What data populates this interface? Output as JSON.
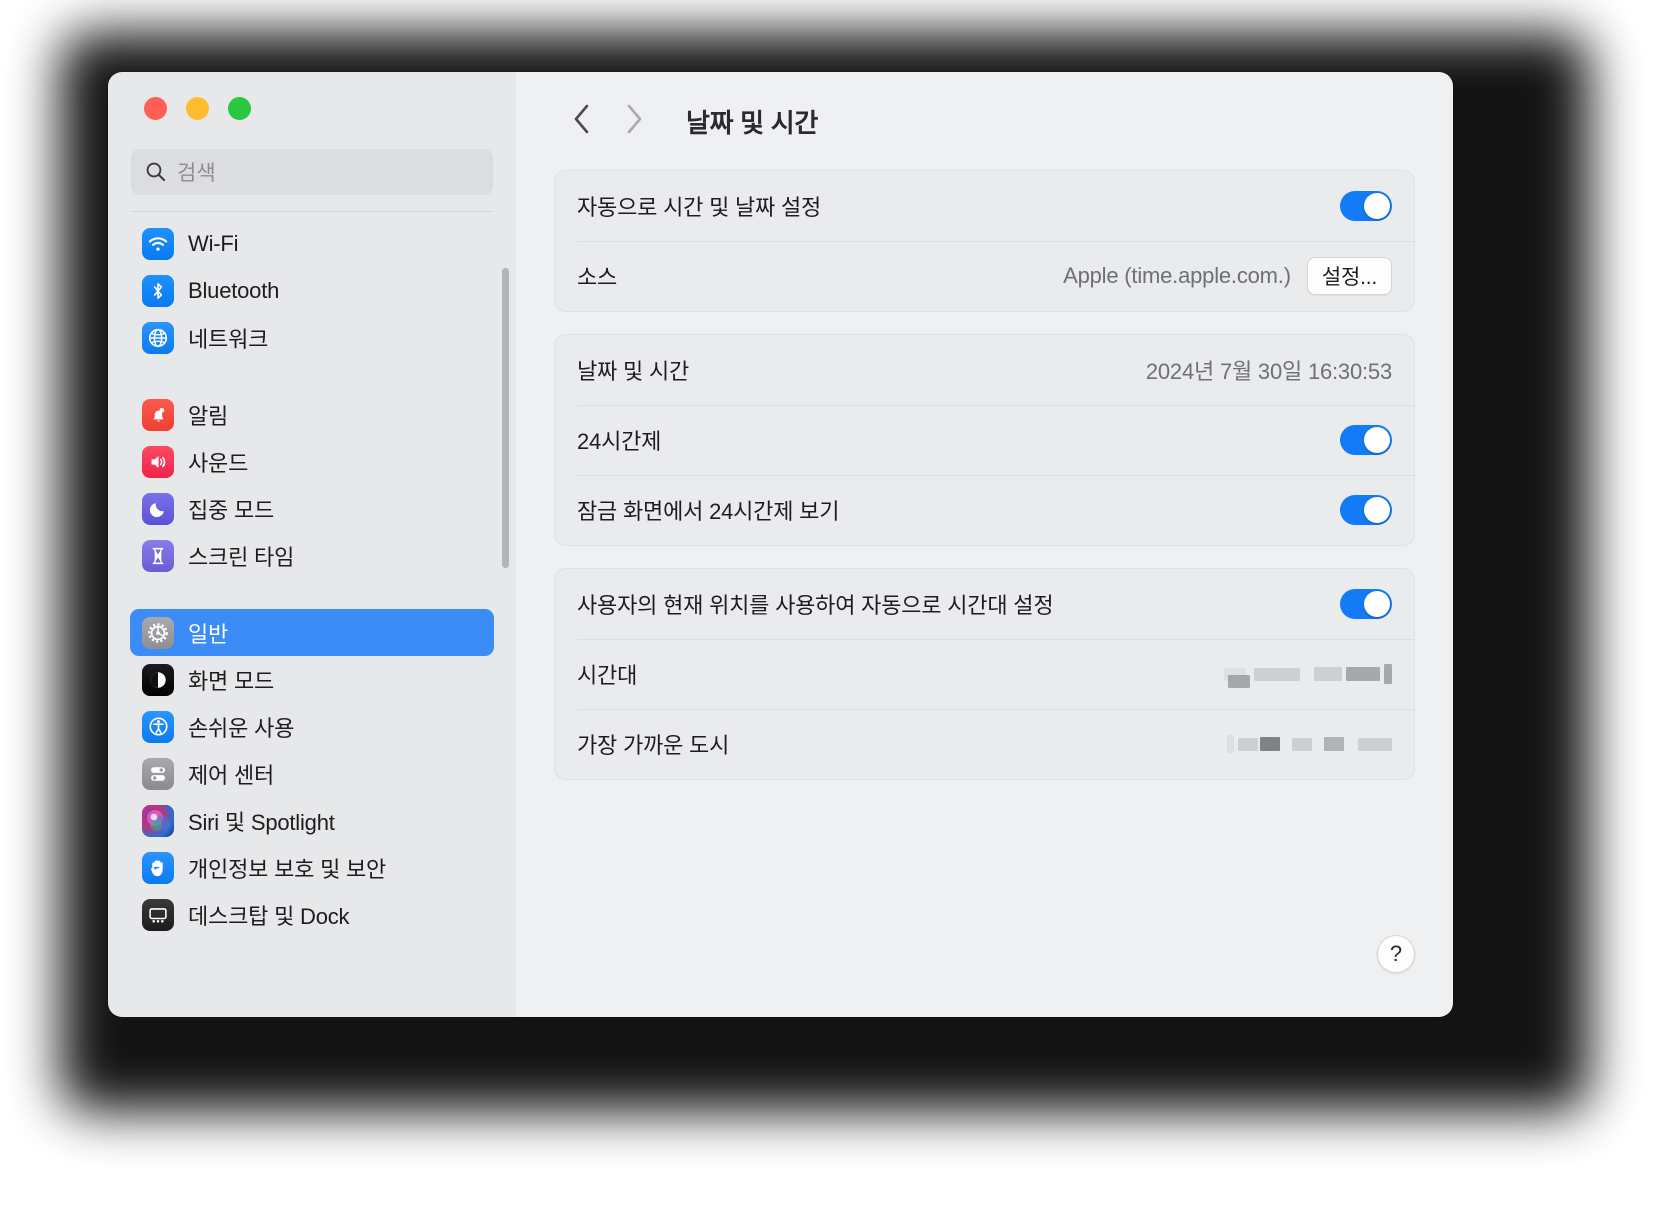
{
  "window": {
    "traffic_lights": [
      {
        "name": "close",
        "color": "#ff5f57"
      },
      {
        "name": "minimize",
        "color": "#febc2e"
      },
      {
        "name": "zoom",
        "color": "#28c840"
      }
    ]
  },
  "search": {
    "placeholder": "검색",
    "icon": "search-icon"
  },
  "sidebar": {
    "groups": [
      {
        "items": [
          {
            "label": "Wi-Fi",
            "icon": "wifi-icon",
            "icon_class": "ic-wifi",
            "selected": false
          },
          {
            "label": "Bluetooth",
            "icon": "bluetooth-icon",
            "icon_class": "ic-bluetooth",
            "selected": false
          },
          {
            "label": "네트워크",
            "icon": "globe-icon",
            "icon_class": "ic-network",
            "selected": false
          }
        ]
      },
      {
        "items": [
          {
            "label": "알림",
            "icon": "bell-icon",
            "icon_class": "ic-notify",
            "selected": false
          },
          {
            "label": "사운드",
            "icon": "speaker-icon",
            "icon_class": "ic-sound",
            "selected": false
          },
          {
            "label": "집중 모드",
            "icon": "moon-icon",
            "icon_class": "ic-focus",
            "selected": false
          },
          {
            "label": "스크린 타임",
            "icon": "hourglass-icon",
            "icon_class": "ic-screen",
            "selected": false
          }
        ]
      },
      {
        "items": [
          {
            "label": "일반",
            "icon": "gear-icon",
            "icon_class": "ic-general",
            "selected": true
          },
          {
            "label": "화면 모드",
            "icon": "appearance-icon",
            "icon_class": "ic-display",
            "selected": false
          },
          {
            "label": "손쉬운 사용",
            "icon": "accessibility-icon",
            "icon_class": "ic-access",
            "selected": false
          },
          {
            "label": "제어 센터",
            "icon": "control-center-icon",
            "icon_class": "ic-control",
            "selected": false
          },
          {
            "label": "Siri 및 Spotlight",
            "icon": "siri-icon",
            "icon_class": "ic-siri",
            "selected": false
          },
          {
            "label": "개인정보 보호 및 보안",
            "icon": "hand-icon",
            "icon_class": "ic-privacy",
            "selected": false
          },
          {
            "label": "데스크탑 및 Dock",
            "icon": "desktop-dock-icon",
            "icon_class": "ic-desktop",
            "selected": false
          }
        ]
      }
    ]
  },
  "toolbar": {
    "back_icon": "chevron-left-icon",
    "forward_icon": "chevron-right-icon",
    "title": "날짜 및 시간"
  },
  "settings": {
    "group1": {
      "auto_datetime_label": "자동으로 시간 및 날짜 설정",
      "auto_datetime_on": true,
      "source_label": "소스",
      "source_value": "Apple (time.apple.com.)",
      "source_button": "설정..."
    },
    "group2": {
      "datetime_label": "날짜 및 시간",
      "datetime_value": "2024년 7월 30일 16:30:53",
      "h24_label": "24시간제",
      "h24_on": true,
      "lockscreen_h24_label": "잠금 화면에서 24시간제 보기",
      "lockscreen_h24_on": true
    },
    "group3": {
      "auto_timezone_label": "사용자의 현재 위치를 사용하여 자동으로 시간대 설정",
      "auto_timezone_on": true,
      "timezone_label": "시간대",
      "timezone_value": "",
      "timezone_redacted": true,
      "closest_city_label": "가장 가까운 도시",
      "closest_city_value": "",
      "closest_city_redacted": true
    }
  },
  "help": {
    "label": "?"
  },
  "colors": {
    "accent": "#127bf5",
    "selection": "#3b8cf7",
    "window_bg": "#eef0f2",
    "sidebar_bg": "#e7e8e9",
    "card_bg": "#eaebed"
  }
}
